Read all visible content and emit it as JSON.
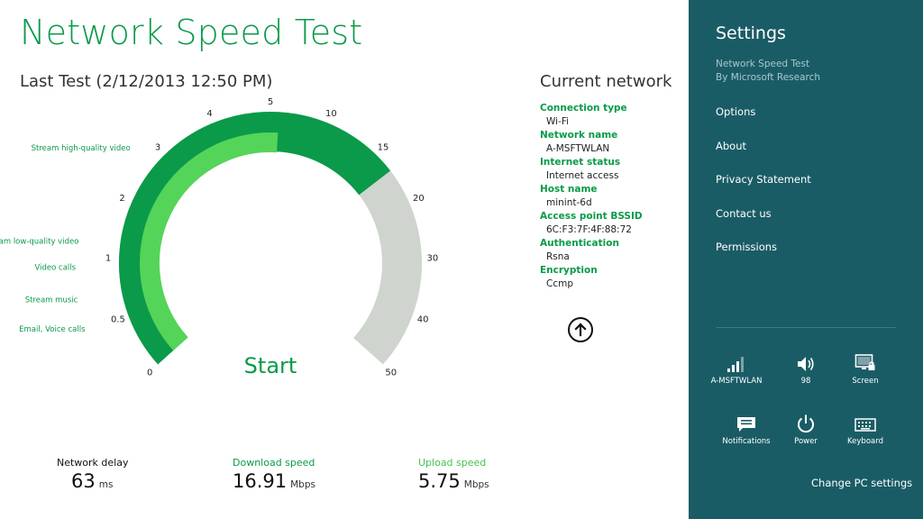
{
  "app": {
    "title": "Network Speed Test",
    "last_test": "Last Test (2/12/2013 12:50 PM)",
    "start_label": "Start"
  },
  "gauge": {
    "ticks": [
      "0",
      "0.5",
      "1",
      "2",
      "3",
      "4",
      "5",
      "10",
      "15",
      "20",
      "30",
      "40",
      "50"
    ],
    "download_speed_mbps": 16.91,
    "upload_speed_mbps": 5.75,
    "usage_labels": [
      "Email, Voice calls",
      "Stream music",
      "Video calls",
      "Stream low-quality video",
      "Stream high-quality video"
    ]
  },
  "metrics": {
    "delay": {
      "label": "Network delay",
      "value": "63",
      "unit": "ms"
    },
    "download": {
      "label": "Download speed",
      "value": "16.91",
      "unit": "Mbps"
    },
    "upload": {
      "label": "Upload speed",
      "value": "5.75",
      "unit": "Mbps"
    }
  },
  "network": {
    "title": "Current network",
    "fields": [
      {
        "key": "Connection type",
        "value": "Wi-Fi"
      },
      {
        "key": "Network name",
        "value": "A-MSFTWLAN"
      },
      {
        "key": "Internet status",
        "value": "Internet access"
      },
      {
        "key": "Host name",
        "value": "minint-6d"
      },
      {
        "key": "Access point BSSID",
        "value": "6C:F3:7F:4F:88:72"
      },
      {
        "key": "Authentication",
        "value": "Rsna"
      },
      {
        "key": "Encryption",
        "value": "Ccmp"
      }
    ]
  },
  "settings": {
    "title": "Settings",
    "app_name": "Network Speed Test",
    "publisher": "By Microsoft Research",
    "menu": [
      "Options",
      "About",
      "Privacy Statement",
      "Contact us",
      "Permissions"
    ],
    "quick": {
      "network": "A-MSFTWLAN",
      "volume": "98",
      "screen": "Screen",
      "notifications": "Notifications",
      "power": "Power",
      "keyboard": "Keyboard"
    },
    "change_pc": "Change PC settings"
  },
  "colors": {
    "accent_dark": "#0a9a49",
    "accent_light": "#55d45a",
    "track": "#cfd4cf",
    "charms_bg": "#1a5c66"
  }
}
